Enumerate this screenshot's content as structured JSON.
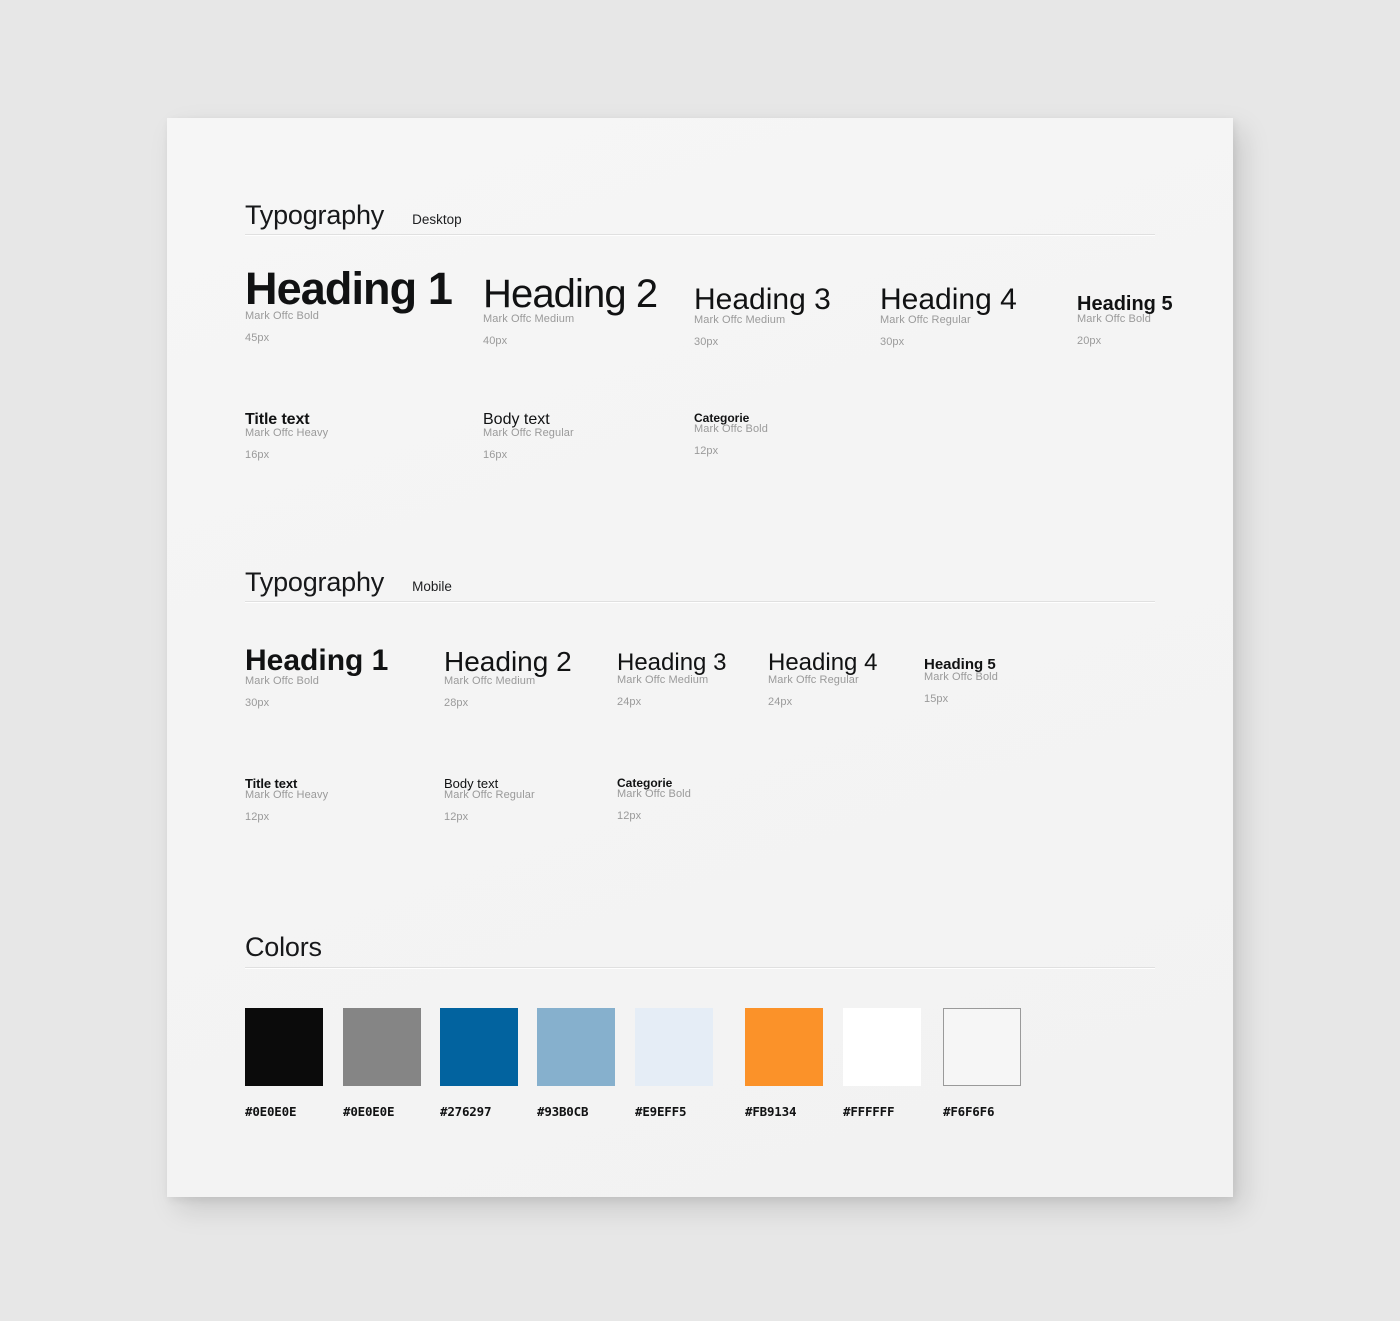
{
  "sections": {
    "typography_desktop": {
      "title": "Typography",
      "qualifier": "Desktop",
      "headings": [
        {
          "sample": "Heading 1",
          "font": "Mark Offc Bold",
          "size": "45px"
        },
        {
          "sample": "Heading 2",
          "font": "Mark Offc Medium",
          "size": "40px"
        },
        {
          "sample": "Heading 3",
          "font": "Mark Offc Medium",
          "size": "30px"
        },
        {
          "sample": "Heading 4",
          "font": "Mark Offc Regular",
          "size": "30px"
        },
        {
          "sample": "Heading 5",
          "font": "Mark Offc Bold",
          "size": "20px"
        }
      ],
      "body_styles": [
        {
          "sample": "Title text",
          "font": "Mark Offc Heavy",
          "size": "16px"
        },
        {
          "sample": "Body text",
          "font": "Mark Offc Regular",
          "size": "16px"
        },
        {
          "sample": "Categorie",
          "font": "Mark Offc Bold",
          "size": "12px"
        }
      ]
    },
    "typography_mobile": {
      "title": "Typography",
      "qualifier": "Mobile",
      "headings": [
        {
          "sample": "Heading 1",
          "font": "Mark Offc Bold",
          "size": "30px"
        },
        {
          "sample": "Heading 2",
          "font": "Mark Offc Medium",
          "size": "28px"
        },
        {
          "sample": "Heading 3",
          "font": "Mark Offc Medium",
          "size": "24px"
        },
        {
          "sample": "Heading 4",
          "font": "Mark Offc Regular",
          "size": "24px"
        },
        {
          "sample": "Heading 5",
          "font": "Mark Offc Bold",
          "size": "15px"
        }
      ],
      "body_styles": [
        {
          "sample": "Title text",
          "font": "Mark Offc Heavy",
          "size": "12px"
        },
        {
          "sample": "Body text",
          "font": "Mark Offc Regular",
          "size": "12px"
        },
        {
          "sample": "Categorie",
          "font": "Mark Offc Bold",
          "size": "12px"
        }
      ]
    },
    "colors": {
      "title": "Colors",
      "swatches": [
        {
          "hex": "#0E0E0E",
          "fill": "#0b0b0b",
          "bordered": false
        },
        {
          "hex": "#0E0E0E",
          "fill": "#858585",
          "bordered": false
        },
        {
          "hex": "#276297",
          "fill": "#02639f",
          "bordered": false
        },
        {
          "hex": "#93B0CB",
          "fill": "#86b0cd",
          "bordered": false
        },
        {
          "hex": "#E9EFF5",
          "fill": "#e5edf6",
          "bordered": false
        },
        {
          "hex": "#FB9134",
          "fill": "#fb9229",
          "bordered": false
        },
        {
          "hex": "#FFFFFF",
          "fill": "#ffffff",
          "bordered": false
        },
        {
          "hex": "#F6F6F6",
          "fill": "#f6f6f6",
          "bordered": true
        }
      ]
    }
  }
}
